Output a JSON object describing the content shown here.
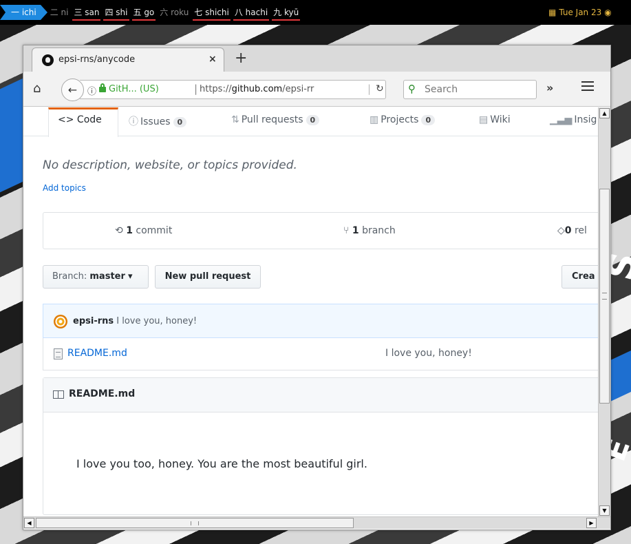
{
  "panel": {
    "workspaces": [
      {
        "label": "一 ichi",
        "state": "active"
      },
      {
        "label": "二 ni",
        "state": "dim"
      },
      {
        "label": "三 san",
        "state": "used"
      },
      {
        "label": "四 shi",
        "state": "used"
      },
      {
        "label": "五 go",
        "state": "used"
      },
      {
        "label": "六 roku",
        "state": "dim"
      },
      {
        "label": "七 shichi",
        "state": "used"
      },
      {
        "label": "八 hachi",
        "state": "used"
      },
      {
        "label": "九 kyū",
        "state": "used"
      }
    ],
    "clock": "Tue Jan 23",
    "accent": "#1e8ae0",
    "clock_color": "#e4b640"
  },
  "browser": {
    "tab_title": "epsi-rns/anycode",
    "tab_close": "×",
    "new_tab": "+",
    "site_identity": "GitH... (US)",
    "url_prefix": "https://",
    "url_host": "github.com",
    "url_path": "/epsi-rr",
    "search_placeholder": "Search",
    "overflow": "»"
  },
  "repo_nav": {
    "code": "Code",
    "issues": "Issues",
    "issues_count": "0",
    "pull_requests": "Pull requests",
    "pull_requests_count": "0",
    "projects": "Projects",
    "projects_count": "0",
    "wiki": "Wiki",
    "insights": "Insig"
  },
  "repo": {
    "description": "No description, website, or topics provided.",
    "add_topics": "Add topics",
    "commits_count": "1",
    "commits_label": "commit",
    "branches_count": "1",
    "branches_label": "branch",
    "releases_count": "0",
    "releases_label": "rel",
    "branch_label": "Branch:",
    "branch_name": "master",
    "new_pull_request": "New pull request",
    "create_button": "Crea"
  },
  "commit": {
    "author": "epsi-rns",
    "message": "I love you, honey!"
  },
  "files": [
    {
      "name": "README.md",
      "message": "I love you, honey!"
    }
  ],
  "readme": {
    "title": "README.md",
    "body": "I love you too, honey. You are the most beautiful girl."
  }
}
